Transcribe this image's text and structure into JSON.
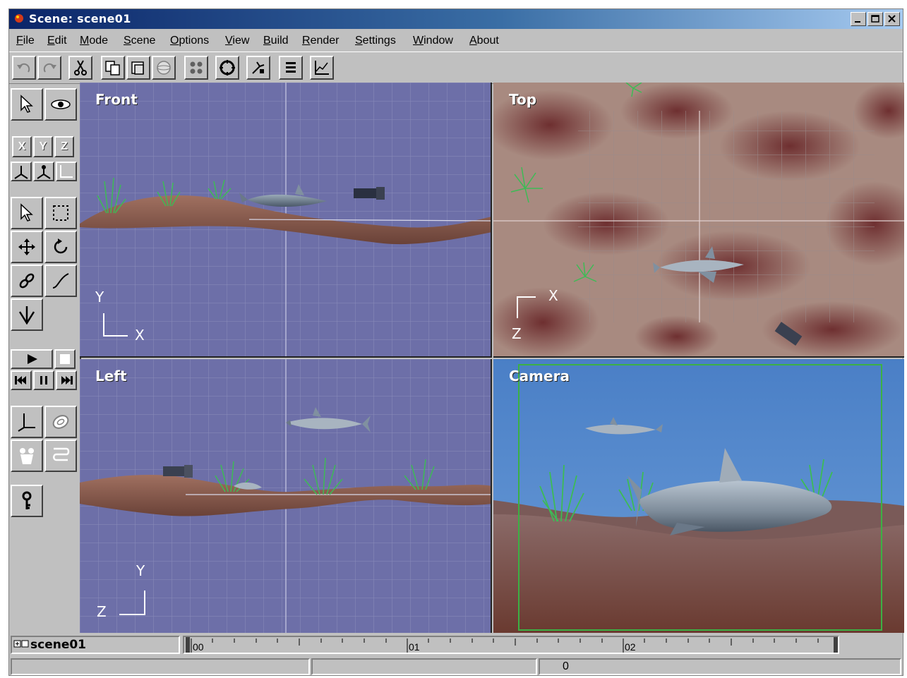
{
  "window": {
    "title": "Scene: scene01"
  },
  "menu": [
    "File",
    "Edit",
    "Mode",
    "Scene",
    "Options",
    "View",
    "Build",
    "Render",
    "Settings",
    "Window",
    "About"
  ],
  "toolbar": {
    "icons": [
      "undo-icon",
      "redo-icon",
      "cut-icon",
      "copy-icon",
      "paste-icon",
      "render-sphere-icon",
      "grid-icon",
      "target-icon",
      "snap-icon",
      "list-icon",
      "graph-icon"
    ]
  },
  "left_toolbar": {
    "axes": [
      "X",
      "Y",
      "Z"
    ]
  },
  "viewports": {
    "front": {
      "label": "Front",
      "axis_v": "Y",
      "axis_h": "X"
    },
    "top": {
      "label": "Top",
      "axis_h": "X",
      "axis_v": "Z"
    },
    "left": {
      "label": "Left",
      "axis_v": "Y",
      "axis_h": "Z"
    },
    "camera": {
      "label": "Camera"
    }
  },
  "colors": {
    "viewport_bg": "#6d6fa8",
    "camera_sky": "#4a7fc6",
    "seabed": "#8a5a4a",
    "grid_line": "#8a8cba",
    "title_bar": "#0a2468"
  },
  "status": {
    "scene_name": "scene01",
    "timeline_marks": [
      "00",
      "01",
      "02"
    ],
    "frame": "0"
  }
}
